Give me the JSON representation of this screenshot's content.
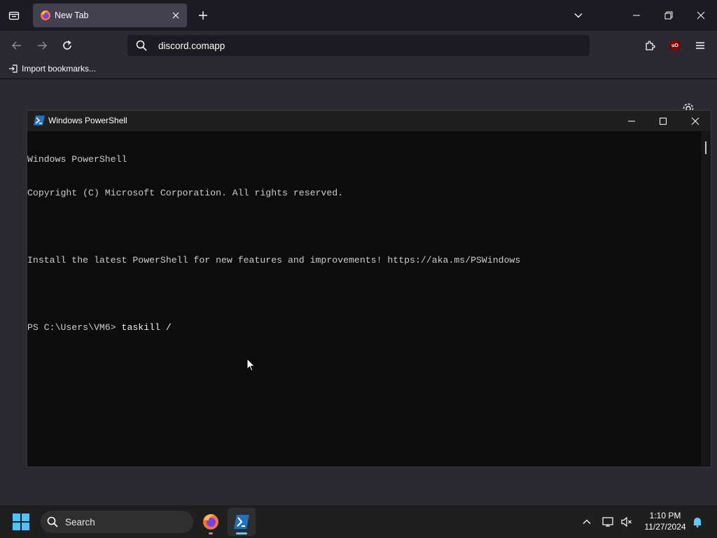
{
  "browser": {
    "tab": {
      "title": "New Tab"
    },
    "url": {
      "value": "discord.comapp",
      "placeholder": ""
    },
    "bookmarks": {
      "import_label": "Import bookmarks..."
    }
  },
  "powershell": {
    "window_title": "Windows PowerShell",
    "lines": [
      "Windows PowerShell",
      "Copyright (C) Microsoft Corporation. All rights reserved.",
      "",
      "Install the latest PowerShell for new features and improvements! https://aka.ms/PSWindows",
      ""
    ],
    "prompt": "PS C:\\Users\\VM6> ",
    "command": "taskill /"
  },
  "taskbar": {
    "search_label": "Search",
    "time": "1:10 PM",
    "date": "11/27/2024"
  },
  "icons": {
    "tab_list": "tab-list-icon",
    "firefox": "firefox-icon",
    "ublock": "ublock-origin-icon",
    "powershell": "powershell-icon"
  },
  "colors": {
    "accent": "#60cdff",
    "windows_blue": "#0078d4",
    "ps_blue": "#2671be"
  }
}
